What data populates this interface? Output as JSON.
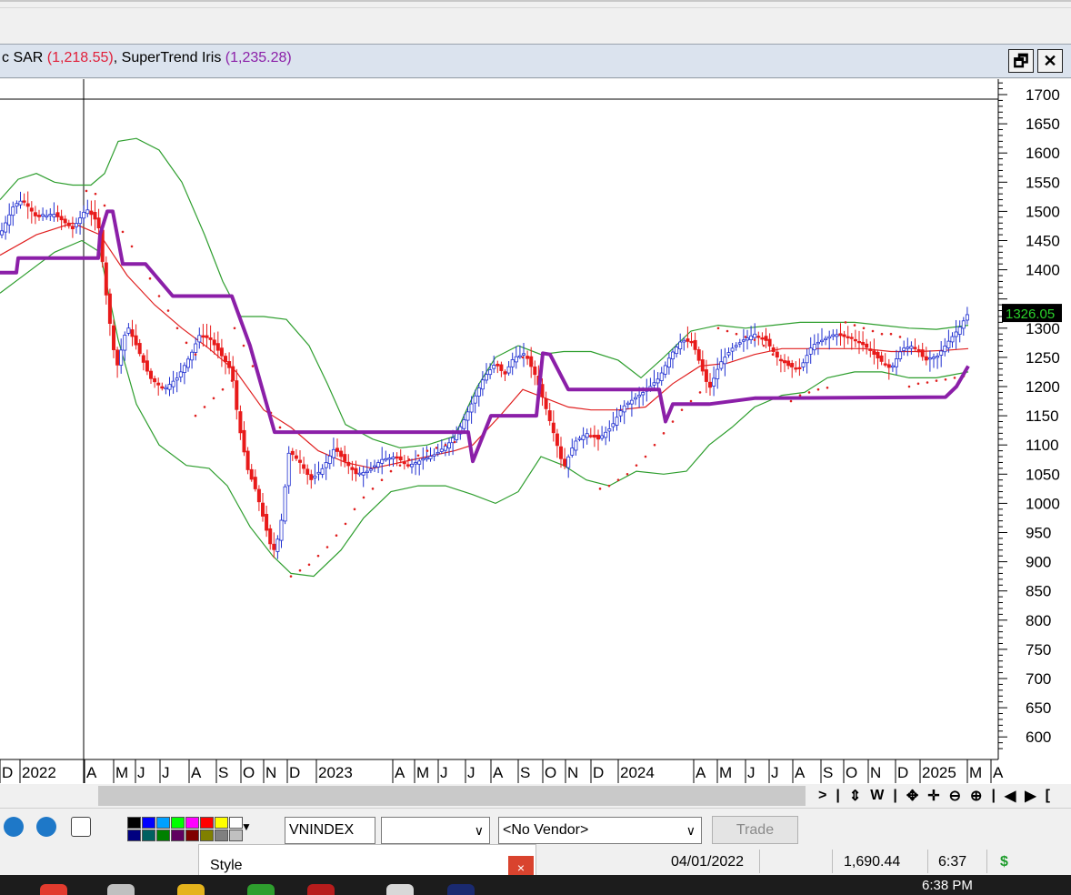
{
  "legend": {
    "sar_label": "c SAR",
    "sar_value": "(1,218.55)",
    "supertrend_label": "SuperTrend Iris",
    "supertrend_value": "(1,235.28)",
    "sar_color": "#e0203a",
    "supertrend_color": "#8b1fa8"
  },
  "window_buttons": {
    "restore": "🗗",
    "close": "✕"
  },
  "chart_data": {
    "type": "candlestick",
    "ylim": [
      560,
      1720
    ],
    "y_ticks": [
      1700,
      1650,
      1600,
      1550,
      1500,
      1450,
      1400,
      1300,
      1250,
      1200,
      1150,
      1100,
      1050,
      1000,
      950,
      900,
      850,
      800,
      750,
      700,
      650,
      600
    ],
    "current_price": "1326.05",
    "x_tick_labels": [
      "D",
      "2022",
      "A",
      "M",
      "J",
      "J",
      "A",
      "S",
      "O",
      "N",
      "D",
      "2023",
      "A",
      "M",
      "J",
      "J",
      "A",
      "S",
      "O",
      "N",
      "D",
      "2024",
      "A",
      "M",
      "J",
      "J",
      "A",
      "S",
      "O",
      "N",
      "D",
      "2025",
      "M",
      "A"
    ],
    "colors": {
      "up": "#1f2fd0",
      "down": "#e81a1a",
      "bands": "#2e9e2e",
      "ma": "#e02020",
      "sar": "#e02020",
      "supertrend": "#8b1fa8"
    },
    "price_path": [
      [
        0,
        1460
      ],
      [
        15,
        1510
      ],
      [
        25,
        1520
      ],
      [
        40,
        1490
      ],
      [
        60,
        1495
      ],
      [
        80,
        1470
      ],
      [
        95,
        1505
      ],
      [
        108,
        1480
      ],
      [
        118,
        1340
      ],
      [
        128,
        1230
      ],
      [
        140,
        1305
      ],
      [
        150,
        1270
      ],
      [
        165,
        1215
      ],
      [
        180,
        1195
      ],
      [
        195,
        1215
      ],
      [
        210,
        1255
      ],
      [
        220,
        1290
      ],
      [
        232,
        1280
      ],
      [
        245,
        1250
      ],
      [
        255,
        1225
      ],
      [
        262,
        1140
      ],
      [
        272,
        1060
      ],
      [
        282,
        1020
      ],
      [
        292,
        960
      ],
      [
        300,
        915
      ],
      [
        308,
        950
      ],
      [
        318,
        1090
      ],
      [
        330,
        1070
      ],
      [
        342,
        1040
      ],
      [
        355,
        1060
      ],
      [
        368,
        1095
      ],
      [
        380,
        1070
      ],
      [
        392,
        1050
      ],
      [
        405,
        1055
      ],
      [
        420,
        1075
      ],
      [
        435,
        1080
      ],
      [
        450,
        1065
      ],
      [
        465,
        1075
      ],
      [
        480,
        1085
      ],
      [
        495,
        1105
      ],
      [
        508,
        1135
      ],
      [
        520,
        1175
      ],
      [
        532,
        1215
      ],
      [
        545,
        1240
      ],
      [
        555,
        1220
      ],
      [
        565,
        1250
      ],
      [
        578,
        1255
      ],
      [
        590,
        1215
      ],
      [
        600,
        1165
      ],
      [
        610,
        1115
      ],
      [
        620,
        1060
      ],
      [
        632,
        1105
      ],
      [
        645,
        1120
      ],
      [
        658,
        1110
      ],
      [
        672,
        1130
      ],
      [
        685,
        1165
      ],
      [
        698,
        1180
      ],
      [
        712,
        1195
      ],
      [
        725,
        1215
      ],
      [
        738,
        1255
      ],
      [
        750,
        1280
      ],
      [
        762,
        1275
      ],
      [
        772,
        1230
      ],
      [
        780,
        1195
      ],
      [
        792,
        1240
      ],
      [
        805,
        1265
      ],
      [
        818,
        1280
      ],
      [
        830,
        1290
      ],
      [
        842,
        1280
      ],
      [
        855,
        1250
      ],
      [
        868,
        1235
      ],
      [
        880,
        1230
      ],
      [
        893,
        1270
      ],
      [
        905,
        1280
      ],
      [
        918,
        1290
      ],
      [
        930,
        1285
      ],
      [
        942,
        1280
      ],
      [
        955,
        1265
      ],
      [
        968,
        1245
      ],
      [
        980,
        1230
      ],
      [
        992,
        1265
      ],
      [
        1005,
        1270
      ],
      [
        1018,
        1245
      ],
      [
        1030,
        1250
      ],
      [
        1042,
        1275
      ],
      [
        1055,
        1300
      ],
      [
        1065,
        1326
      ]
    ],
    "ma_path": [
      [
        0,
        1425
      ],
      [
        40,
        1460
      ],
      [
        80,
        1480
      ],
      [
        110,
        1460
      ],
      [
        140,
        1390
      ],
      [
        170,
        1340
      ],
      [
        200,
        1300
      ],
      [
        230,
        1265
      ],
      [
        260,
        1225
      ],
      [
        290,
        1160
      ],
      [
        320,
        1130
      ],
      [
        350,
        1090
      ],
      [
        380,
        1070
      ],
      [
        410,
        1060
      ],
      [
        440,
        1070
      ],
      [
        470,
        1080
      ],
      [
        500,
        1090
      ],
      [
        520,
        1100
      ],
      [
        550,
        1150
      ],
      [
        575,
        1195
      ],
      [
        600,
        1180
      ],
      [
        625,
        1165
      ],
      [
        650,
        1160
      ],
      [
        680,
        1160
      ],
      [
        710,
        1165
      ],
      [
        740,
        1205
      ],
      [
        770,
        1235
      ],
      [
        800,
        1240
      ],
      [
        830,
        1255
      ],
      [
        860,
        1265
      ],
      [
        890,
        1265
      ],
      [
        920,
        1265
      ],
      [
        950,
        1265
      ],
      [
        980,
        1260
      ],
      [
        1010,
        1260
      ],
      [
        1040,
        1262
      ],
      [
        1065,
        1265
      ]
    ],
    "upper_band": [
      [
        0,
        1520
      ],
      [
        20,
        1555
      ],
      [
        40,
        1565
      ],
      [
        60,
        1550
      ],
      [
        80,
        1545
      ],
      [
        100,
        1545
      ],
      [
        115,
        1565
      ],
      [
        130,
        1620
      ],
      [
        150,
        1625
      ],
      [
        175,
        1605
      ],
      [
        200,
        1550
      ],
      [
        225,
        1460
      ],
      [
        245,
        1380
      ],
      [
        265,
        1320
      ],
      [
        290,
        1320
      ],
      [
        315,
        1315
      ],
      [
        340,
        1270
      ],
      [
        360,
        1205
      ],
      [
        380,
        1135
      ],
      [
        410,
        1110
      ],
      [
        440,
        1095
      ],
      [
        470,
        1100
      ],
      [
        500,
        1115
      ],
      [
        525,
        1200
      ],
      [
        545,
        1250
      ],
      [
        570,
        1270
      ],
      [
        595,
        1255
      ],
      [
        620,
        1260
      ],
      [
        650,
        1260
      ],
      [
        680,
        1245
      ],
      [
        705,
        1215
      ],
      [
        730,
        1250
      ],
      [
        760,
        1295
      ],
      [
        790,
        1305
      ],
      [
        820,
        1300
      ],
      [
        850,
        1305
      ],
      [
        880,
        1310
      ],
      [
        910,
        1310
      ],
      [
        940,
        1310
      ],
      [
        970,
        1305
      ],
      [
        1000,
        1300
      ],
      [
        1030,
        1298
      ],
      [
        1065,
        1305
      ]
    ],
    "lower_band": [
      [
        0,
        1360
      ],
      [
        30,
        1395
      ],
      [
        60,
        1430
      ],
      [
        90,
        1450
      ],
      [
        110,
        1430
      ],
      [
        130,
        1280
      ],
      [
        150,
        1170
      ],
      [
        175,
        1100
      ],
      [
        205,
        1065
      ],
      [
        230,
        1060
      ],
      [
        250,
        1030
      ],
      [
        275,
        960
      ],
      [
        300,
        910
      ],
      [
        320,
        880
      ],
      [
        345,
        875
      ],
      [
        375,
        920
      ],
      [
        400,
        975
      ],
      [
        430,
        1020
      ],
      [
        460,
        1030
      ],
      [
        490,
        1030
      ],
      [
        520,
        1015
      ],
      [
        545,
        1000
      ],
      [
        570,
        1020
      ],
      [
        595,
        1080
      ],
      [
        620,
        1065
      ],
      [
        645,
        1040
      ],
      [
        670,
        1030
      ],
      [
        700,
        1055
      ],
      [
        730,
        1050
      ],
      [
        755,
        1055
      ],
      [
        780,
        1100
      ],
      [
        805,
        1130
      ],
      [
        830,
        1165
      ],
      [
        860,
        1185
      ],
      [
        885,
        1190
      ],
      [
        910,
        1215
      ],
      [
        940,
        1225
      ],
      [
        970,
        1225
      ],
      [
        1000,
        1215
      ],
      [
        1030,
        1215
      ],
      [
        1065,
        1225
      ]
    ],
    "supertrend_path": [
      [
        0,
        1395
      ],
      [
        18,
        1395
      ],
      [
        20,
        1420
      ],
      [
        108,
        1420
      ],
      [
        110,
        1460
      ],
      [
        118,
        1500
      ],
      [
        124,
        1500
      ],
      [
        135,
        1410
      ],
      [
        160,
        1410
      ],
      [
        190,
        1355
      ],
      [
        255,
        1355
      ],
      [
        275,
        1270
      ],
      [
        302,
        1122
      ],
      [
        515,
        1122
      ],
      [
        520,
        1072
      ],
      [
        540,
        1150
      ],
      [
        590,
        1150
      ],
      [
        597,
        1257
      ],
      [
        605,
        1255
      ],
      [
        625,
        1195
      ],
      [
        725,
        1195
      ],
      [
        732,
        1140
      ],
      [
        740,
        1170
      ],
      [
        780,
        1170
      ],
      [
        830,
        1180
      ],
      [
        1040,
        1182
      ],
      [
        1052,
        1200
      ],
      [
        1065,
        1235
      ]
    ],
    "sar_segments": [
      [
        [
          95,
          1535
        ],
        [
          105,
          1530
        ],
        [
          115,
          1510
        ],
        [
          125,
          1490
        ],
        [
          135,
          1465
        ],
        [
          145,
          1440
        ],
        [
          155,
          1410
        ],
        [
          165,
          1385
        ],
        [
          175,
          1355
        ],
        [
          185,
          1330
        ],
        [
          195,
          1300
        ],
        [
          205,
          1275
        ],
        [
          215,
          1255
        ]
      ],
      [
        [
          215,
          1150
        ],
        [
          225,
          1165
        ],
        [
          235,
          1180
        ],
        [
          245,
          1195
        ],
        [
          255,
          1210
        ]
      ],
      [
        [
          258,
          1300
        ],
        [
          268,
          1270
        ],
        [
          278,
          1235
        ],
        [
          288,
          1195
        ],
        [
          298,
          1155
        ],
        [
          308,
          1130
        ]
      ],
      [
        [
          320,
          875
        ],
        [
          330,
          885
        ],
        [
          340,
          895
        ],
        [
          350,
          910
        ],
        [
          360,
          925
        ],
        [
          370,
          945
        ],
        [
          380,
          965
        ],
        [
          390,
          990
        ],
        [
          400,
          1010
        ],
        [
          410,
          1025
        ],
        [
          420,
          1040
        ],
        [
          430,
          1055
        ],
        [
          440,
          1065
        ],
        [
          450,
          1075
        ],
        [
          460,
          1082
        ],
        [
          470,
          1090
        ],
        [
          480,
          1095
        ],
        [
          490,
          1100
        ],
        [
          500,
          1105
        ]
      ],
      [
        [
          575,
          1250
        ],
        [
          585,
          1240
        ]
      ],
      [
        [
          660,
          1025
        ],
        [
          670,
          1030
        ],
        [
          680,
          1040
        ],
        [
          690,
          1050
        ],
        [
          700,
          1065
        ],
        [
          710,
          1080
        ],
        [
          720,
          1100
        ],
        [
          730,
          1120
        ],
        [
          740,
          1140
        ],
        [
          750,
          1160
        ],
        [
          760,
          1175
        ],
        [
          770,
          1190
        ]
      ],
      [
        [
          790,
          1300
        ],
        [
          800,
          1295
        ],
        [
          810,
          1290
        ],
        [
          820,
          1285
        ],
        [
          830,
          1280
        ],
        [
          840,
          1270
        ],
        [
          850,
          1255
        ],
        [
          860,
          1245
        ],
        [
          870,
          1235
        ]
      ],
      [
        [
          870,
          1175
        ],
        [
          880,
          1185
        ],
        [
          890,
          1190
        ],
        [
          900,
          1195
        ],
        [
          910,
          1198
        ]
      ],
      [
        [
          930,
          1310
        ],
        [
          940,
          1305
        ],
        [
          950,
          1300
        ],
        [
          960,
          1295
        ],
        [
          970,
          1290
        ],
        [
          980,
          1290
        ],
        [
          990,
          1285
        ]
      ],
      [
        [
          1000,
          1200
        ],
        [
          1010,
          1205
        ],
        [
          1020,
          1207
        ],
        [
          1030,
          1210
        ],
        [
          1040,
          1212
        ],
        [
          1050,
          1215
        ],
        [
          1060,
          1218
        ]
      ]
    ]
  },
  "nav": {
    "items": [
      ">",
      "|",
      "⇕",
      "W",
      "|",
      "✥",
      "✛",
      "⊖",
      "⊕",
      "|",
      "◀",
      "▶",
      "["
    ]
  },
  "toolbar": {
    "symbol": "VNINDEX",
    "vendor": "<No Vendor>",
    "trade": "Trade",
    "palette_colors": [
      "#000000",
      "#0000ff",
      "#00a0ff",
      "#00ff00",
      "#ff00ff",
      "#ff0000",
      "#ffff00",
      "#ffffff",
      "#000080",
      "#006060",
      "#008000",
      "#600060",
      "#800000",
      "#808000",
      "#808080",
      "#c0c0c0"
    ]
  },
  "style_panel": {
    "label": "Style",
    "close": "×"
  },
  "status": {
    "date": "04/01/2022",
    "value": "1,690.44",
    "time": "6:37",
    "currency": "$"
  },
  "taskbar": {
    "clock": "6:38 PM"
  }
}
